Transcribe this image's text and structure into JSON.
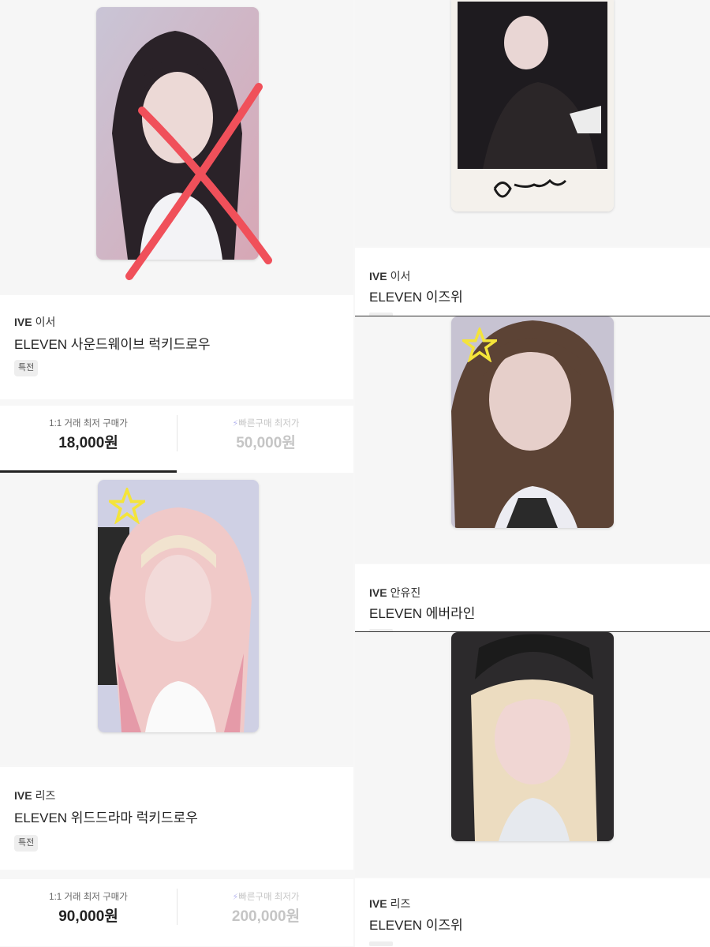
{
  "listings": [
    {
      "brand": "IVE",
      "member": "이서",
      "title": "ELEVEN 사운드웨이브 럭키드로우",
      "tag": "특전",
      "price_label": "1:1 거래 최저 구매가",
      "price": "18,000원",
      "quick_label": "빠른구매 최저가",
      "quick_price": "50,000원"
    },
    {
      "brand": "IVE",
      "member": "리즈",
      "title": "ELEVEN 위드드라마 럭키드로우",
      "tag": "특전",
      "price_label": "1:1 거래 최저 구매가",
      "price": "90,000원",
      "quick_label": "빠른구매 최저가",
      "quick_price": "200,000원"
    },
    {
      "brand": "IVE",
      "member": "이서",
      "title": "ELEVEN 이즈위"
    },
    {
      "brand": "IVE",
      "member": "안유진",
      "title": "ELEVEN 에버라인"
    },
    {
      "brand": "IVE",
      "member": "리즈",
      "title": "ELEVEN 이즈위"
    }
  ],
  "colors": {
    "accent_bolt": "#b9b9f0",
    "cross_mark": "#f0505a"
  },
  "icons": [
    "bolt-icon",
    "star-sticker-icon",
    "cross-out-mark"
  ]
}
